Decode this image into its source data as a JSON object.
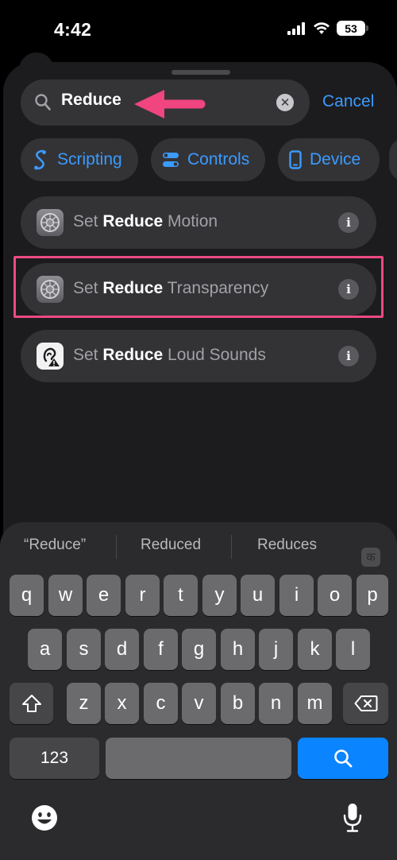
{
  "status": {
    "time": "4:42",
    "battery": "53"
  },
  "search": {
    "query": "Reduce",
    "cancel_label": "Cancel"
  },
  "chips": [
    {
      "label": "Scripting",
      "icon": "scripting-icon"
    },
    {
      "label": "Controls",
      "icon": "controls-toggle-icon"
    },
    {
      "label": "Device",
      "icon": "device-phone-icon"
    }
  ],
  "results": [
    {
      "prefix": "Set ",
      "bold": "Reduce",
      "suffix": " Motion",
      "icon": "settings-gear-icon"
    },
    {
      "prefix": "Set ",
      "bold": "Reduce",
      "suffix": " Transparency",
      "icon": "settings-gear-icon"
    },
    {
      "prefix": "Set ",
      "bold": "Reduce",
      "suffix": " Loud Sounds",
      "icon": "ear-warning-icon"
    }
  ],
  "info_label": "i",
  "keyboard": {
    "suggestions": [
      "“Reduce”",
      "Reduced",
      "Reduces"
    ],
    "language_key": "क",
    "row1": [
      "q",
      "w",
      "e",
      "r",
      "t",
      "y",
      "u",
      "i",
      "o",
      "p"
    ],
    "row2": [
      "a",
      "s",
      "d",
      "f",
      "g",
      "h",
      "j",
      "k",
      "l"
    ],
    "row3": [
      "z",
      "x",
      "c",
      "v",
      "b",
      "n",
      "m"
    ],
    "numbers_label": "123"
  },
  "colors": {
    "accent_blue": "#3b9bff",
    "highlight_pink": "#ec4a82",
    "annotation_arrow": "#f0457f"
  }
}
